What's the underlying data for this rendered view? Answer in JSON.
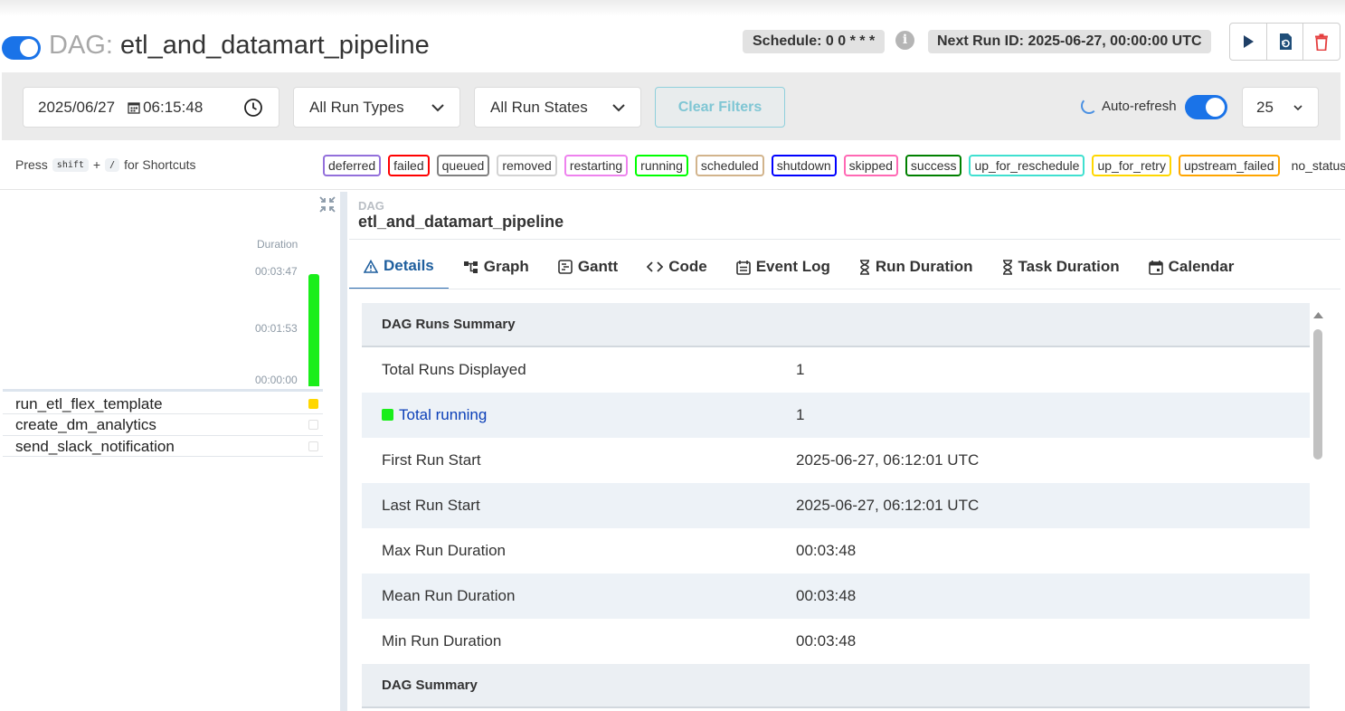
{
  "header": {
    "dag_prefix": "DAG:",
    "dag_name": "etl_and_datamart_pipeline",
    "schedule": "Schedule: 0 0 * * *",
    "next_run": "Next Run ID: 2025-06-27, 00:00:00 UTC",
    "dag_toggle_on": true
  },
  "filters": {
    "date": "2025/06/27",
    "time": "06:15:48",
    "run_types": "All Run Types",
    "run_states": "All Run States",
    "clear_label": "Clear Filters",
    "autorefresh_label": "Auto-refresh",
    "autorefresh_on": true,
    "num_runs": "25"
  },
  "shortcuts": {
    "press": "Press",
    "key1": "shift",
    "plus": "+",
    "key2": "/",
    "suffix": "for Shortcuts"
  },
  "states": [
    {
      "label": "deferred",
      "color": "#9370db"
    },
    {
      "label": "failed",
      "color": "#ff0000"
    },
    {
      "label": "queued",
      "color": "#808080"
    },
    {
      "label": "removed",
      "color": "#d3d3d3"
    },
    {
      "label": "restarting",
      "color": "#ee82ee"
    },
    {
      "label": "running",
      "color": "#00ff00"
    },
    {
      "label": "scheduled",
      "color": "#d2b48c"
    },
    {
      "label": "shutdown",
      "color": "#0000ff"
    },
    {
      "label": "skipped",
      "color": "#ff69b4"
    },
    {
      "label": "success",
      "color": "#008000"
    },
    {
      "label": "up_for_reschedule",
      "color": "#40e0d0"
    },
    {
      "label": "up_for_retry",
      "color": "#ffd700"
    },
    {
      "label": "upstream_failed",
      "color": "#ffa500"
    },
    {
      "label": "no_status",
      "color": ""
    }
  ],
  "grid": {
    "duration_label": "Duration",
    "ticks": [
      "00:03:47",
      "00:01:53",
      "00:00:00"
    ],
    "run_duration_fraction": 1.0,
    "run_bar_color": "#1aee1a",
    "tasks": [
      {
        "name": "run_etl_flex_template",
        "status_color": "#ffd700"
      },
      {
        "name": "create_dm_analytics",
        "status_color": ""
      },
      {
        "name": "send_slack_notification",
        "status_color": ""
      }
    ]
  },
  "details": {
    "small_label": "DAG",
    "dag_name": "etl_and_datamart_pipeline",
    "tabs": [
      {
        "label": "Details",
        "icon": "warning-triangle-icon",
        "active": true
      },
      {
        "label": "Graph",
        "icon": "graph-icon"
      },
      {
        "label": "Gantt",
        "icon": "gantt-icon"
      },
      {
        "label": "Code",
        "icon": "code-icon"
      },
      {
        "label": "Event Log",
        "icon": "event-log-icon"
      },
      {
        "label": "Run Duration",
        "icon": "hourglass-icon"
      },
      {
        "label": "Task Duration",
        "icon": "hourglass-icon"
      },
      {
        "label": "Calendar",
        "icon": "calendar-icon"
      }
    ],
    "runs_summary_title": "DAG Runs Summary",
    "rows": [
      {
        "key": "Total Runs Displayed",
        "value": "1"
      },
      {
        "key": "Total running",
        "value": "1"
      },
      {
        "key": "First Run Start",
        "value": "2025-06-27, 06:12:01 UTC"
      },
      {
        "key": "Last Run Start",
        "value": "2025-06-27, 06:12:01 UTC"
      },
      {
        "key": "Max Run Duration",
        "value": "00:03:48"
      },
      {
        "key": "Mean Run Duration",
        "value": "00:03:48"
      },
      {
        "key": "Min Run Duration",
        "value": "00:03:48"
      }
    ],
    "dag_summary_title": "DAG Summary"
  }
}
